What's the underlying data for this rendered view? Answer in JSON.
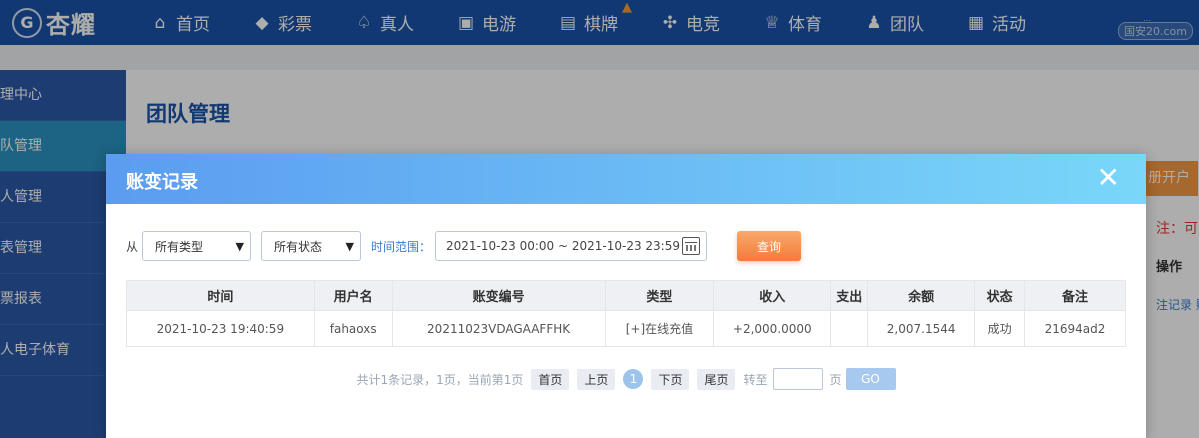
{
  "nav": {
    "logo_badge": "G",
    "logo_text": "杏耀",
    "items": [
      {
        "label": "首页",
        "icon": "home-icon"
      },
      {
        "label": "彩票",
        "icon": "ticket-icon"
      },
      {
        "label": "真人",
        "icon": "dealer-icon"
      },
      {
        "label": "电游",
        "icon": "slot-icon"
      },
      {
        "label": "棋牌",
        "icon": "cards-icon"
      },
      {
        "label": "电竞",
        "icon": "gamepad-icon"
      },
      {
        "label": "体育",
        "icon": "trophy-icon"
      },
      {
        "label": "团队",
        "icon": "team-icon"
      },
      {
        "label": "活动",
        "icon": "gift-icon"
      }
    ],
    "watermark": "国安20.com"
  },
  "sidebar": {
    "items": [
      {
        "label": "理中心"
      },
      {
        "label": "队管理"
      },
      {
        "label": "人管理"
      },
      {
        "label": "表管理"
      },
      {
        "label": "票报表"
      },
      {
        "label": "人电子体育"
      }
    ]
  },
  "page": {
    "title": "团队管理",
    "bg_button": "册开户",
    "bg_note": "注：可",
    "bg_col": "操作",
    "bg_links": "注记录 账"
  },
  "modal": {
    "title": "账变记录",
    "close": "✕",
    "filters": {
      "from_label": "从",
      "type_select": "所有类型",
      "status_select": "所有状态",
      "time_label": "时间范围：",
      "date_range": "2021-10-23 00:00 ~ 2021-10-23 23:59",
      "query_button": "查询"
    },
    "table": {
      "headers": [
        "时间",
        "用户名",
        "账变编号",
        "类型",
        "收入",
        "支出",
        "余额",
        "状态",
        "备注"
      ],
      "rows": [
        {
          "time": "2021-10-23 19:40:59",
          "username": "fahaoxs",
          "txn_no": "20211023VDAGAAFFHK",
          "type": "[+]在线充值",
          "income": "+2,000.0000",
          "expense": "",
          "balance": "2,007.1544",
          "status": "成功",
          "remark": "21694ad2"
        }
      ]
    },
    "pager": {
      "summary": "共计1条记录，1页，当前第1页",
      "first": "首页",
      "prev": "上页",
      "current": "1",
      "next": "下页",
      "last": "尾页",
      "goto_label": "转至",
      "page_unit": "页",
      "go": "GO"
    }
  }
}
